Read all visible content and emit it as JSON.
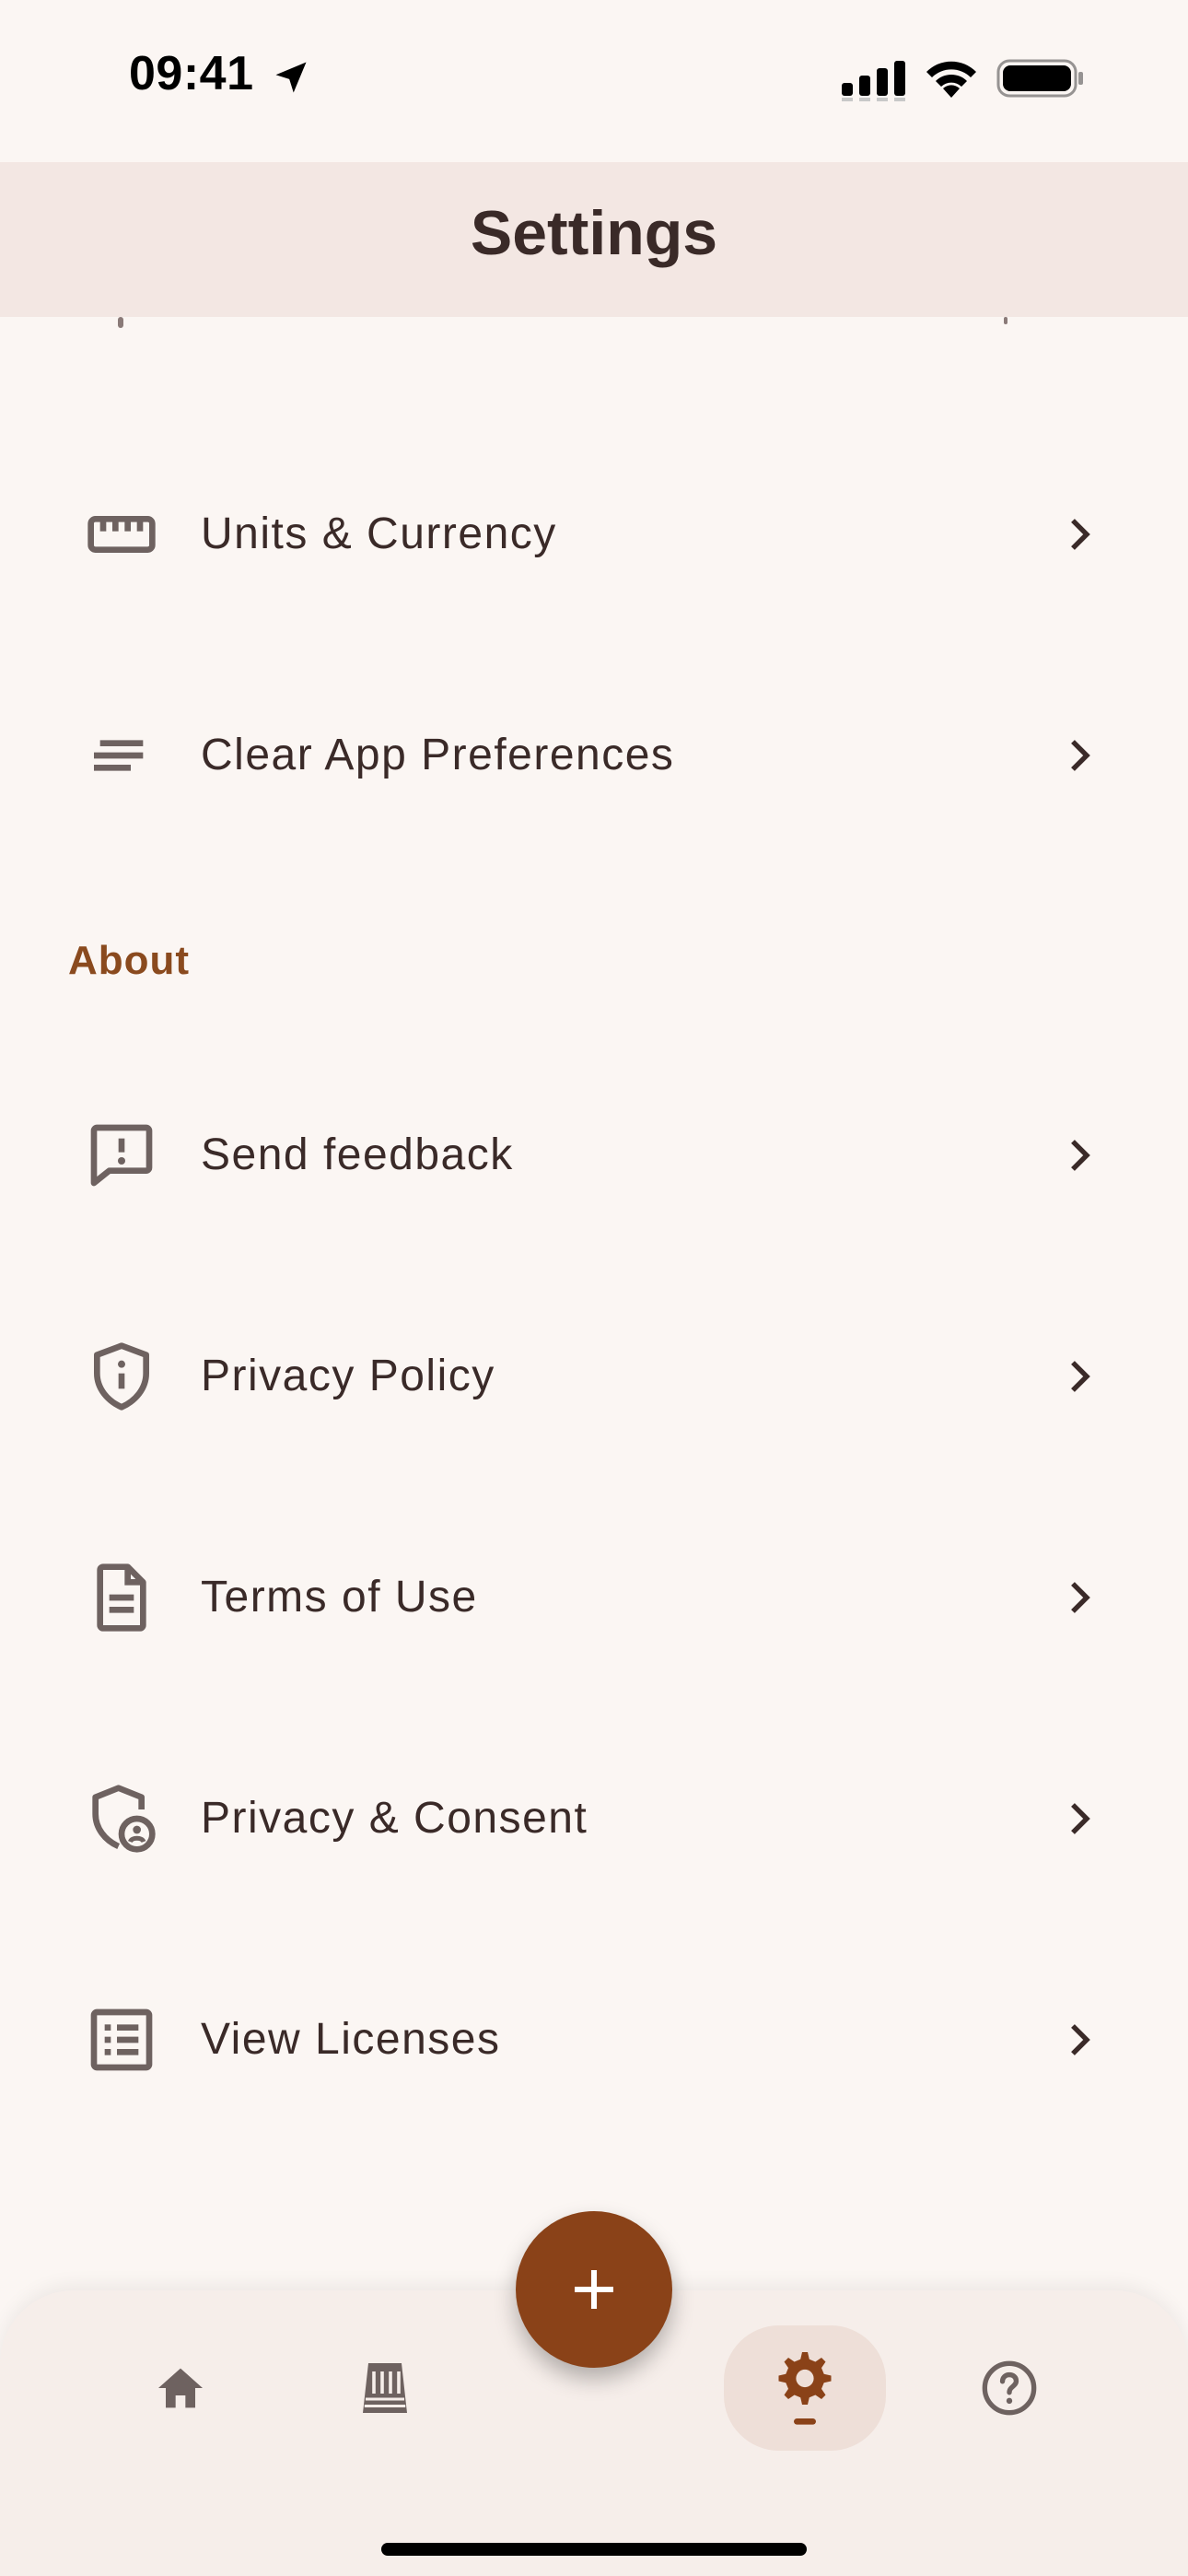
{
  "status_bar": {
    "time": "09:41"
  },
  "app_bar": {
    "title": "Settings"
  },
  "items_top": [
    {
      "label": "Units & Currency",
      "icon": "ruler-icon"
    },
    {
      "label": "Clear App Preferences",
      "icon": "notes-lines-icon"
    }
  ],
  "about_section": {
    "header": "About",
    "items": [
      {
        "label": "Send feedback",
        "icon": "feedback-icon"
      },
      {
        "label": "Privacy Policy",
        "icon": "shield-info-icon"
      },
      {
        "label": "Terms of Use",
        "icon": "document-icon"
      },
      {
        "label": "Privacy & Consent",
        "icon": "shield-person-icon"
      },
      {
        "label": "View Licenses",
        "icon": "list-icon"
      }
    ]
  },
  "bottom_nav": {
    "items": [
      "home-icon",
      "ledger-icon",
      "settings-icon",
      "help-icon"
    ],
    "active": "settings-icon"
  },
  "fab": {
    "icon": "plus-icon"
  },
  "colors": {
    "background": "#FBF6F3",
    "app_bar": "#F3E7E3",
    "accent": "#8A4218",
    "section_header": "#8A4A1E",
    "text": "#3A2A28",
    "icon": "#6E6260"
  }
}
